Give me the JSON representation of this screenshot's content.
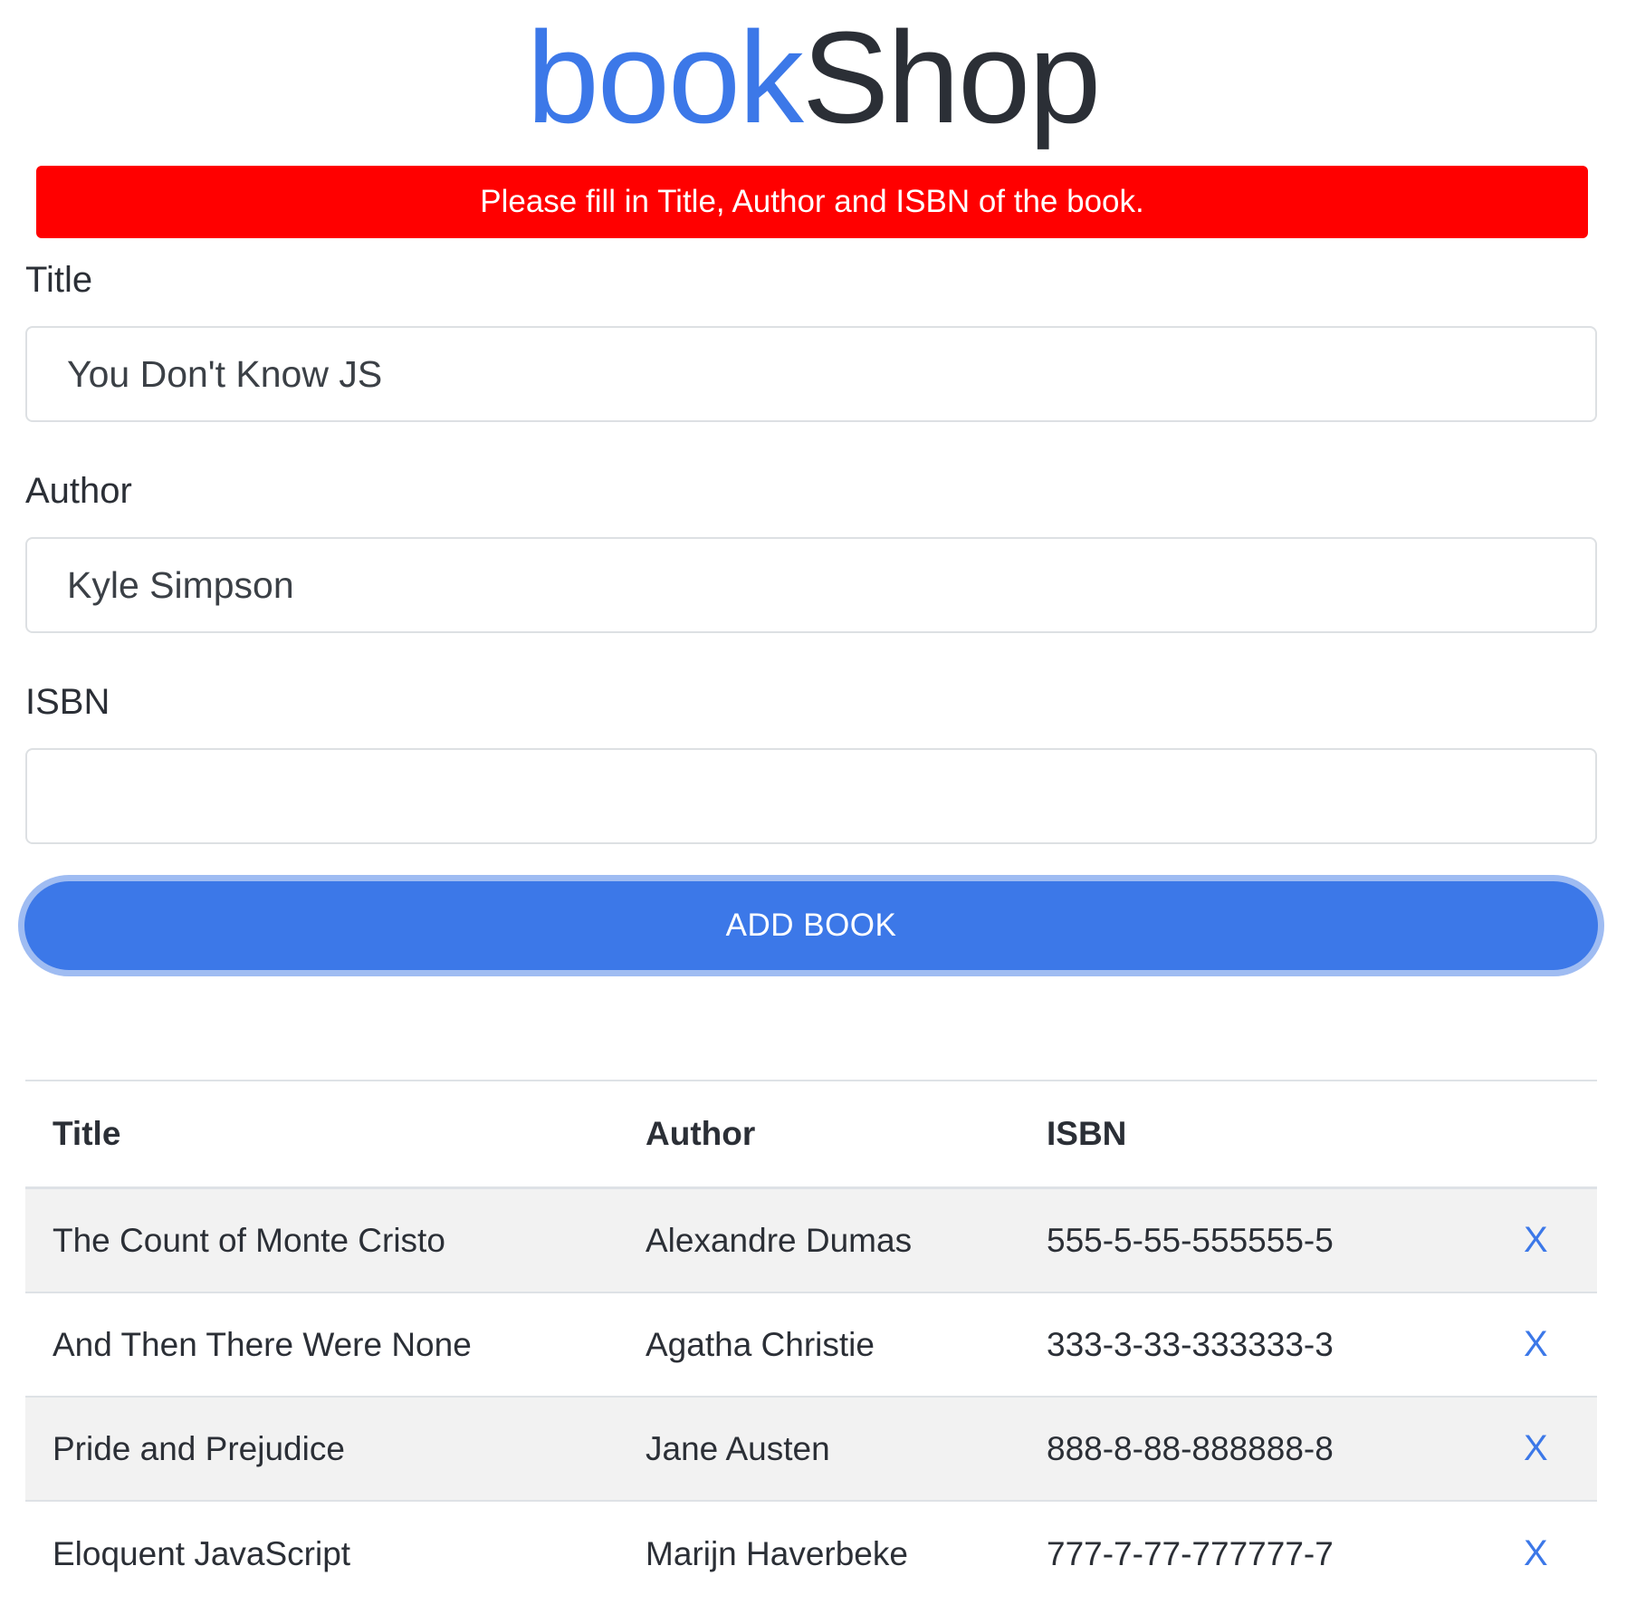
{
  "brand": {
    "part1": "book",
    "part2": "Shop"
  },
  "colors": {
    "brand_blue": "#3c78e8",
    "brand_dark": "#2b2f36",
    "alert_red": "#ff0000",
    "button_blue": "#3c78e8",
    "row_stripe": "#f2f2f2"
  },
  "alert": {
    "message": "Please fill in Title, Author and ISBN of the book."
  },
  "form": {
    "title_label": "Title",
    "title_value": "You Don't Know JS",
    "author_label": "Author",
    "author_value": "Kyle Simpson",
    "isbn_label": "ISBN",
    "isbn_value": "",
    "submit_label": "ADD BOOK"
  },
  "table": {
    "headers": {
      "title": "Title",
      "author": "Author",
      "isbn": "ISBN"
    },
    "delete_label": "X",
    "rows": [
      {
        "title": "The Count of Monte Cristo",
        "author": "Alexandre Dumas",
        "isbn": "555-5-55-555555-5"
      },
      {
        "title": "And Then There Were None",
        "author": "Agatha Christie",
        "isbn": "333-3-33-333333-3"
      },
      {
        "title": "Pride and Prejudice",
        "author": "Jane Austen",
        "isbn": "888-8-88-888888-8"
      },
      {
        "title": "Eloquent JavaScript",
        "author": "Marijn Haverbeke",
        "isbn": "777-7-77-777777-7"
      }
    ]
  }
}
